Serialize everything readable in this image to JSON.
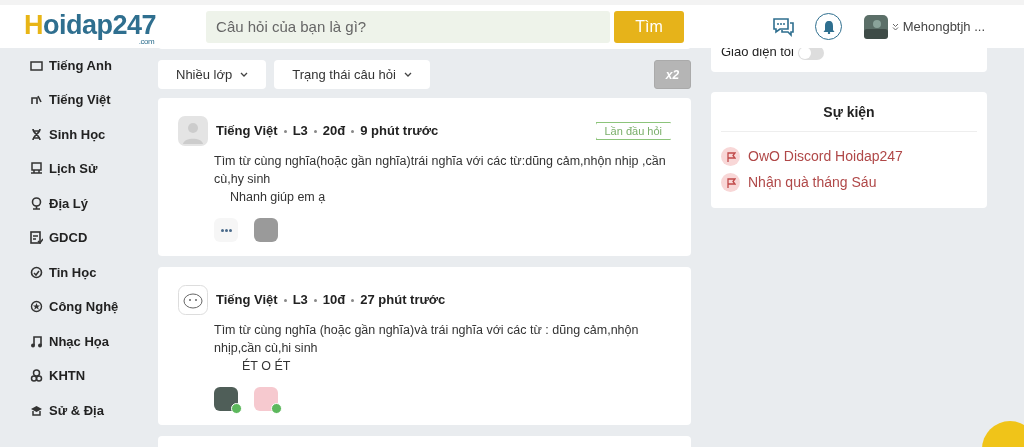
{
  "header": {
    "logo": "Hoidap247",
    "logo_suffix": ".com",
    "search_placeholder": "Câu hỏi của bạn là gì?",
    "search_button": "Tìm",
    "user_name": "Mehongbtjh ..."
  },
  "sidebar": {
    "items": [
      {
        "label": "Tiếng Anh"
      },
      {
        "label": "Tiếng Việt"
      },
      {
        "label": "Sinh Học"
      },
      {
        "label": "Lịch Sử"
      },
      {
        "label": "Địa Lý"
      },
      {
        "label": "GDCD"
      },
      {
        "label": "Tin Học"
      },
      {
        "label": "Công Nghệ"
      },
      {
        "label": "Nhạc Họa"
      },
      {
        "label": "KHTN"
      },
      {
        "label": "Sử & Địa"
      }
    ]
  },
  "settings": {
    "label": "Giao diện tối",
    "on": false
  },
  "filters": [
    "Nhiều lớp",
    "Trạng thái câu hỏi"
  ],
  "multiplier_button": "x2",
  "questions": [
    {
      "subject": "Tiếng Việt",
      "grade": "L3",
      "points": "20đ",
      "time": "9 phút trước",
      "badge": "Lần đầu hỏi",
      "text": "Tìm từ cùng nghĩa(hoặc gần nghĩa)trái nghĩa với các từ:dũng cảm,nhộn nhịp ,cần cù,hy sinh",
      "note": "Nhanh giúp em ạ",
      "answers": [
        {
          "checked": false
        },
        {
          "checked": false
        }
      ]
    },
    {
      "subject": "Tiếng Việt",
      "grade": "L3",
      "points": "10đ",
      "time": "27 phút trước",
      "text": "Tìm từ cùng nghĩa (hoặc gần nghĩa)và trái nghĩa với các từ : dũng cảm,nhộn nhịp,cần cù,hi sinh",
      "note": "ÉT O ÉT",
      "answers": [
        {
          "checked": true
        },
        {
          "checked": true
        }
      ]
    }
  ],
  "events": {
    "title": "Sự kiện",
    "items": [
      "OwO Discord Hoidap247",
      "Nhận quà tháng Sáu"
    ]
  }
}
